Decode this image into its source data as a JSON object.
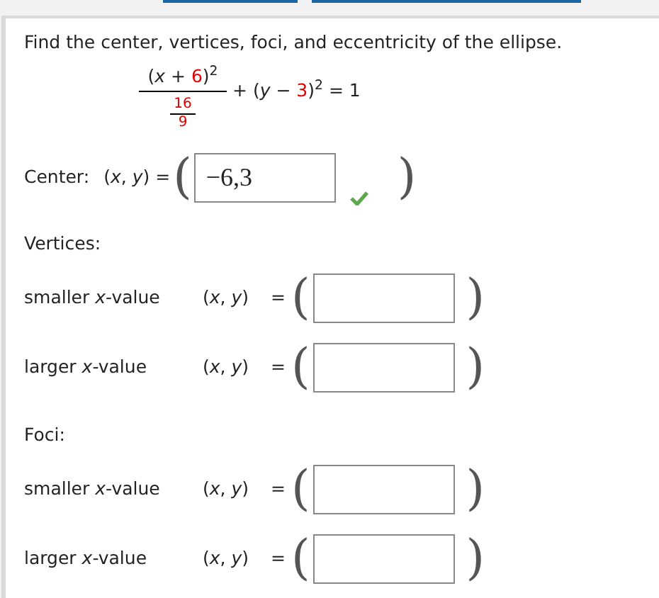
{
  "prompt": "Find the center, vertices, foci, and eccentricity of the ellipse.",
  "equation": {
    "numerator": [
      {
        "text": "(*x* + ",
        "given": false
      },
      {
        "text": "6",
        "given": true
      },
      {
        "text": ")$^{2}$",
        "given": false
      }
    ],
    "denominator_top": [
      {
        "text": "16",
        "given": true
      }
    ],
    "denominator_bottom": [
      {
        "text": "9",
        "given": true
      }
    ],
    "rest": [
      {
        "text": "+ (*y* − ",
        "given": false
      },
      {
        "text": "3",
        "given": true
      },
      {
        "text": ")$^{2}$ = 1",
        "given": false
      }
    ]
  },
  "center": {
    "label": "Center:",
    "variable": "(*x*, *y*) =",
    "open": "(",
    "value": "−6,3",
    "correct": true,
    "close": ")"
  },
  "sections": [
    {
      "title": "Vertices:",
      "rows": [
        {
          "label": "smaller *x*-value",
          "variable": "(*x*, *y*)",
          "equals": "=",
          "open": "(",
          "close": ")"
        },
        {
          "label": "larger *x*-value",
          "variable": "(*x*, *y*)",
          "equals": "=",
          "open": "(",
          "close": ")"
        }
      ]
    },
    {
      "title": "Foci:",
      "rows": [
        {
          "label": "smaller *x*-value",
          "variable": "(*x*, *y*)",
          "equals": "=",
          "open": "(",
          "close": ")"
        },
        {
          "label": "larger *x*-value",
          "variable": "(*x*, *y*)",
          "equals": "=",
          "open": "(",
          "close": ")"
        }
      ]
    }
  ]
}
